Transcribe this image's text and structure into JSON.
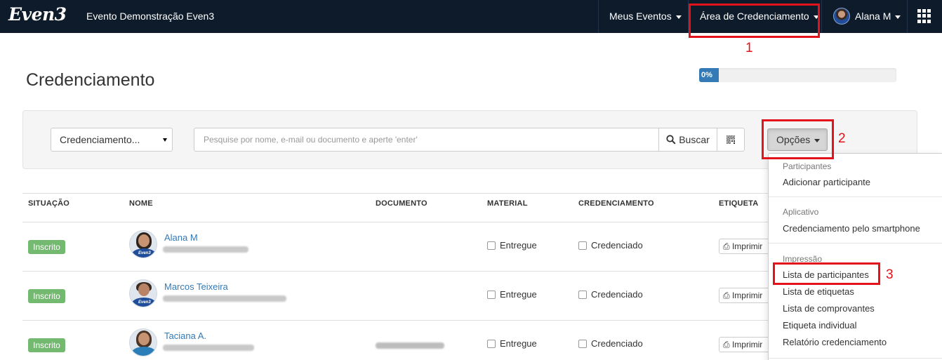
{
  "navbar": {
    "logo": "Even3",
    "event_name": "Evento Demonstração Even3",
    "menu_meus_eventos": "Meus Eventos",
    "menu_area_credenciamento": "Área de Credenciamento",
    "user_name": "Alana M",
    "bg_color": "#0e1b2b"
  },
  "annotations": {
    "n1": "1",
    "n2": "2",
    "n3": "3",
    "color": "#e2131a"
  },
  "page": {
    "title": "Credenciamento",
    "progress_label": "0%",
    "progress_value": 0
  },
  "filters": {
    "select_value": "Credenciamento...",
    "search_placeholder": "Pesquise por nome, e-mail ou documento e aperte 'enter'",
    "search_button": "Buscar",
    "options_button": "Opções"
  },
  "table": {
    "headers": [
      "SITUAÇÃO",
      "NOME",
      "DOCUMENTO",
      "MATERIAL",
      "CREDENCIAMENTO",
      "ETIQUETA"
    ],
    "rows": [
      {
        "status": "Inscrito",
        "name": "Alana M",
        "material": "Entregue",
        "credenciamento": "Credenciado",
        "print": "Imprimir"
      },
      {
        "status": "Inscrito",
        "name": "Marcos Teixeira",
        "material": "Entregue",
        "credenciamento": "Credenciado",
        "print": "Imprimir"
      },
      {
        "status": "Inscrito",
        "name": "Taciana A.",
        "material": "Entregue",
        "credenciamento": "Credenciado",
        "print": "Imprimir"
      }
    ]
  },
  "dropdown": {
    "participantes_header": "Participantes",
    "adicionar": "Adicionar participante",
    "aplicativo_header": "Aplicativo",
    "credenciamento_smartphone": "Credenciamento pelo smartphone",
    "impressao_header": "Impressão",
    "lista_participantes": "Lista de participantes",
    "lista_etiquetas": "Lista de etiquetas",
    "lista_comprovantes": "Lista de comprovantes",
    "etiqueta_individual": "Etiqueta individual",
    "relatorio": "Relatório credenciamento"
  }
}
